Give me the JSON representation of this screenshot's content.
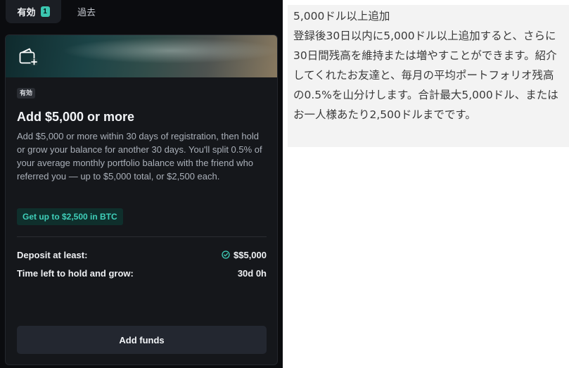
{
  "tabs": {
    "active_label": "有効",
    "active_count": "1",
    "past_label": "過去"
  },
  "card": {
    "status": "有効",
    "title": "Add $5,000 or more",
    "description": "Add $5,000 or more within 30 days of registration, then hold or grow your balance for another 30 days. You'll split 0.5% of your average monthly portfolio balance with the friend who referred you — up to $5,000 total, or $2,500 each.",
    "reward": "Get up to $2,500 in BTC",
    "rows": [
      {
        "label": "Deposit at least:",
        "value": "$$5,000"
      },
      {
        "label": "Time left to hold and grow:",
        "value": "30d 0h"
      }
    ],
    "button_label": "Add funds"
  },
  "translation": {
    "title": "5,000ドル以上追加",
    "body": "登録後30日以内に5,000ドル以上追加すると、さらに30日間残高を維持または増やすことができます。紹介してくれたお友達と、毎月の平均ポートフォリオ残高の0.5%を山分けします。合計最大5,000ドル、またはお一人様あたり2,500ドルまでです。"
  },
  "colors": {
    "panel_bg": "#0b0c0f",
    "card_bg": "#15171b",
    "accent_teal": "#3fd0ba",
    "button_bg": "#232730"
  },
  "icons": [
    "wallet-plus-icon",
    "check-circle-icon"
  ]
}
